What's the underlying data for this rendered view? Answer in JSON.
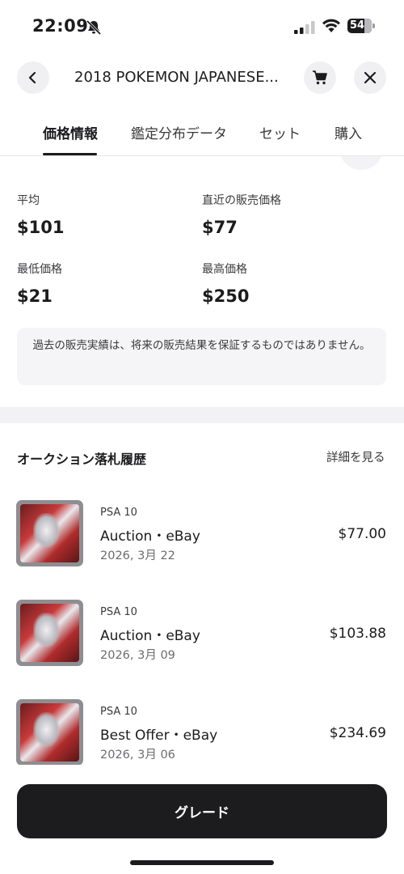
{
  "status_bar": {
    "time": "22:09",
    "battery": "54",
    "icons": [
      "bell-muted-icon",
      "cellular-signal-icon",
      "wifi-icon",
      "battery-icon"
    ]
  },
  "header": {
    "title": "2018 POKEMON JAPANESE...",
    "back_icon": "chevron-left-icon",
    "cart_icon": "cart-icon",
    "close_icon": "close-icon"
  },
  "tabs": [
    {
      "label": "価格情報",
      "active": true
    },
    {
      "label": "鑑定分布データ",
      "active": false
    },
    {
      "label": "セット",
      "active": false
    },
    {
      "label": "購入",
      "active": false
    }
  ],
  "stats": {
    "average": {
      "label": "平均",
      "value": "$101"
    },
    "recent": {
      "label": "直近の販売価格",
      "value": "$77"
    },
    "min": {
      "label": "最低価格",
      "value": "$21"
    },
    "max": {
      "label": "最高価格",
      "value": "$250"
    }
  },
  "disclaimer": "過去の販売実績は、将来の販売結果を保証するものではありません。",
  "auction_history": {
    "title": "オークション落札履歴",
    "link": "詳細を見る",
    "sales": [
      {
        "grade": "PSA 10",
        "type": "Auction・eBay",
        "date": "2026, 3月 22",
        "price": "$77.00"
      },
      {
        "grade": "PSA 10",
        "type": "Auction・eBay",
        "date": "2026, 3月 09",
        "price": "$103.88"
      },
      {
        "grade": "PSA 10",
        "type": "Best Offer・eBay",
        "date": "2026, 3月 06",
        "price": "$234.69"
      }
    ]
  },
  "footer": {
    "button_label": "グレード"
  },
  "colors": {
    "primary": "#1c1c1e",
    "muted_bg": "#f5f5f7",
    "divider": "#e6e6e8"
  }
}
